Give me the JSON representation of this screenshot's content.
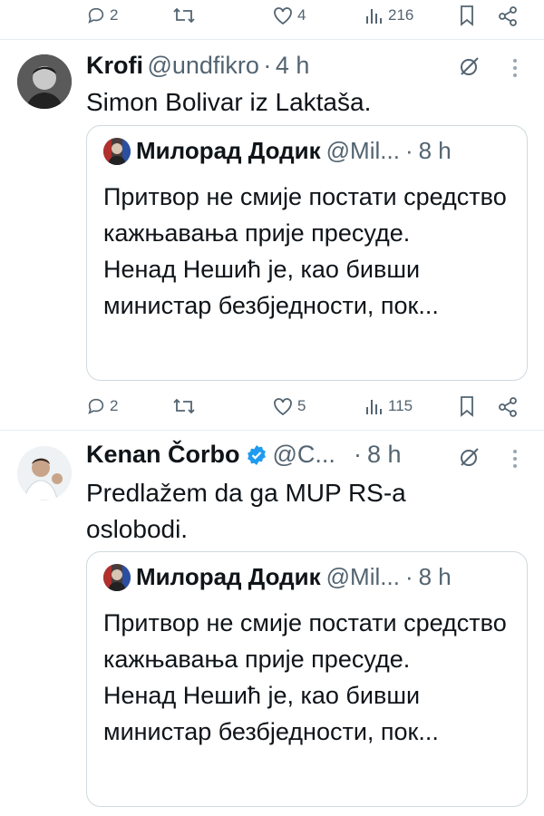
{
  "top_actions": {
    "replies": "2",
    "reposts": "",
    "likes": "4",
    "views": "216"
  },
  "tweet1": {
    "name": "Krofi",
    "handle": "@undfikro",
    "separator": "·",
    "time": "4 h",
    "text": "Simon Bolivar iz Laktaša.",
    "quote": {
      "name": "Милорад Додик",
      "handle": "@Mil...",
      "separator": "·",
      "time": "8 h",
      "lines": [
        "Притвор не смије постати средство кажњавања прије пресуде.",
        "Ненад Нешић је, као бивши министар безбједности, пок..."
      ]
    },
    "actions": {
      "replies": "2",
      "reposts": "",
      "likes": "5",
      "views": "115"
    }
  },
  "tweet2": {
    "name": "Kenan Čorbo",
    "verified": true,
    "handle": "@C...",
    "separator": "·",
    "time": "8 h",
    "text": "Predlažem da ga MUP RS-a oslobodi.",
    "quote": {
      "name": "Милорад Додик",
      "handle": "@Mil...",
      "separator": "·",
      "time": "8 h",
      "lines": [
        "Притвор не смије постати средство кажњавања прије пресуде.",
        "Ненад Нешић је, као бивши министар безбједности, пок..."
      ]
    }
  },
  "colors": {
    "text": "#0f1419",
    "muted": "#536471",
    "verified": "#1d9bf0",
    "border": "#cfd9de"
  },
  "icons": [
    "reply-icon",
    "repost-icon",
    "like-icon",
    "views-icon",
    "bookmark-icon",
    "share-icon",
    "grok-icon",
    "more-icon",
    "verified-badge-icon"
  ]
}
